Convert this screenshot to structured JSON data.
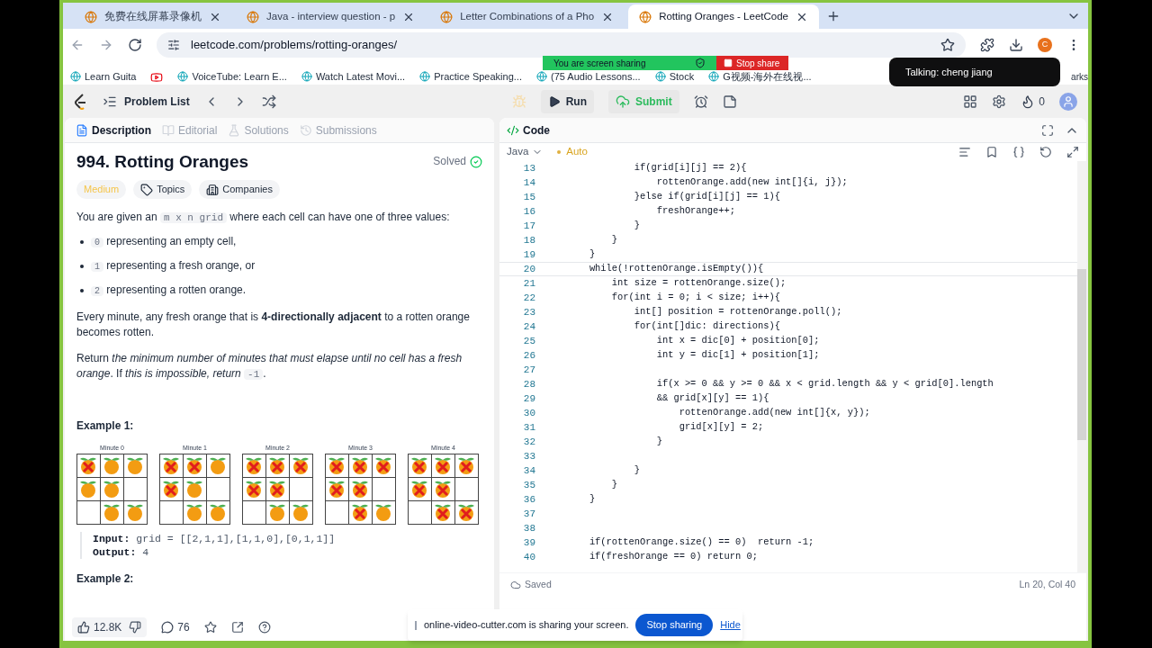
{
  "browser": {
    "tabs": [
      {
        "title": "免费在线屏幕录像机",
        "selected": false
      },
      {
        "title": "Java - interview question - p",
        "selected": false
      },
      {
        "title": "Letter Combinations of a Pho",
        "selected": false
      },
      {
        "title": "Rotting Oranges - LeetCode",
        "selected": true
      }
    ],
    "url": "leetcode.com/problems/rotting-oranges/",
    "bookmarks": [
      {
        "kind": "link",
        "label": "Learn Guita"
      },
      {
        "kind": "icon"
      },
      {
        "kind": "link",
        "label": "VoiceTube: Learn E..."
      },
      {
        "kind": "link",
        "label": "Watch Latest Movi..."
      },
      {
        "kind": "link",
        "label": "Practice Speaking..."
      },
      {
        "kind": "link",
        "label": "(75 Audio Lessons..."
      },
      {
        "kind": "link",
        "label": "Stock"
      },
      {
        "kind": "link",
        "label": "G视频-海外在线视..."
      }
    ],
    "bookmarks_end": "arks",
    "profile_initial": "C"
  },
  "share_banner": {
    "text": "You are screen sharing",
    "button": "Stop share"
  },
  "talking": "Talking: cheng jiang",
  "nav": {
    "problem_list": "Problem List",
    "run": "Run",
    "submit": "Submit",
    "streak": "0"
  },
  "left_tabs": [
    {
      "label": "Description",
      "selected": true
    },
    {
      "label": "Editorial",
      "selected": false
    },
    {
      "label": "Solutions",
      "selected": false
    },
    {
      "label": "Submissions",
      "selected": false
    }
  ],
  "problem": {
    "title": "994. Rotting Oranges",
    "status": "Solved",
    "difficulty": "Medium",
    "tags": [
      "Topics",
      "Companies"
    ],
    "intro": [
      {
        "kind": "text",
        "text": "You are given an "
      },
      {
        "kind": "code",
        "text": "m x n grid"
      },
      {
        "kind": "text",
        "text": " where each cell can have one of three values:"
      }
    ],
    "bullets": [
      {
        "code": "0",
        "text": "representing an empty cell,"
      },
      {
        "code": "1",
        "text": "representing a fresh orange, or"
      },
      {
        "code": "2",
        "text": "representing a rotten orange."
      }
    ],
    "rule": "Every minute, any fresh orange that is **4-directionally adjacent** to a rotten orange becomes rotten.",
    "goal": [
      {
        "kind": "text",
        "text": "Return "
      },
      {
        "kind": "italic",
        "text": "the minimum number of minutes that must elapse until no cell has a fresh orange"
      },
      {
        "kind": "text",
        "text": ". If "
      },
      {
        "kind": "italic",
        "text": "this is impossible, return "
      },
      {
        "kind": "code",
        "text": "-1"
      },
      {
        "kind": "text",
        "text": "."
      }
    ],
    "example_title": "Example 1:",
    "grids": [
      {
        "caption": "Minute 0",
        "cells": [
          [
            {
              "kind": "rotten"
            },
            {
              "kind": "fresh"
            },
            {
              "kind": "fresh"
            }
          ],
          [
            {
              "kind": "fresh"
            },
            {
              "kind": "fresh"
            },
            {
              "kind": "empty"
            }
          ],
          [
            {
              "kind": "empty"
            },
            {
              "kind": "fresh"
            },
            {
              "kind": "fresh"
            }
          ]
        ]
      },
      {
        "caption": "Minute 1",
        "cells": [
          [
            {
              "kind": "rotten"
            },
            {
              "kind": "rotten"
            },
            {
              "kind": "fresh"
            }
          ],
          [
            {
              "kind": "rotten"
            },
            {
              "kind": "fresh"
            },
            {
              "kind": "empty"
            }
          ],
          [
            {
              "kind": "empty"
            },
            {
              "kind": "fresh"
            },
            {
              "kind": "fresh"
            }
          ]
        ]
      },
      {
        "caption": "Minute 2",
        "cells": [
          [
            {
              "kind": "rotten"
            },
            {
              "kind": "rotten"
            },
            {
              "kind": "rotten"
            }
          ],
          [
            {
              "kind": "rotten"
            },
            {
              "kind": "rotten"
            },
            {
              "kind": "empty"
            }
          ],
          [
            {
              "kind": "empty"
            },
            {
              "kind": "fresh"
            },
            {
              "kind": "fresh"
            }
          ]
        ]
      },
      {
        "caption": "Minute 3",
        "cells": [
          [
            {
              "kind": "rotten"
            },
            {
              "kind": "rotten"
            },
            {
              "kind": "rotten"
            }
          ],
          [
            {
              "kind": "rotten"
            },
            {
              "kind": "rotten"
            },
            {
              "kind": "empty"
            }
          ],
          [
            {
              "kind": "empty"
            },
            {
              "kind": "rotten"
            },
            {
              "kind": "fresh"
            }
          ]
        ]
      },
      {
        "caption": "Minute 4",
        "cells": [
          [
            {
              "kind": "rotten"
            },
            {
              "kind": "rotten"
            },
            {
              "kind": "rotten"
            }
          ],
          [
            {
              "kind": "rotten"
            },
            {
              "kind": "rotten"
            },
            {
              "kind": "empty"
            }
          ],
          [
            {
              "kind": "empty"
            },
            {
              "kind": "rotten"
            },
            {
              "kind": "rotten"
            }
          ]
        ]
      }
    ],
    "io": [
      {
        "label": "Input:",
        "value": "grid = [[2,1,1],[1,1,0],[0,1,1]]"
      },
      {
        "label": "Output:",
        "value": "4"
      }
    ],
    "next_example": "Example 2:",
    "likes": "12.8K",
    "comments": "76"
  },
  "editor": {
    "title": "Code",
    "language": "Java",
    "mode": "Auto",
    "lines": [
      {
        "number": "13",
        "text": "                if(grid[i][j] == 2){",
        "current": false
      },
      {
        "number": "14",
        "text": "                    rottenOrange.add(new int[]{i, j});",
        "current": false
      },
      {
        "number": "15",
        "text": "                }else if(grid[i][j] == 1){",
        "current": false
      },
      {
        "number": "16",
        "text": "                    freshOrange++;",
        "current": false
      },
      {
        "number": "17",
        "text": "                }",
        "current": false
      },
      {
        "number": "18",
        "text": "            }",
        "current": false
      },
      {
        "number": "19",
        "text": "        }",
        "current": false
      },
      {
        "number": "20",
        "text": "        while(!rottenOrange.isEmpty()){",
        "current": true
      },
      {
        "number": "21",
        "text": "            int size = rottenOrange.size();",
        "current": false
      },
      {
        "number": "22",
        "text": "            for(int i = 0; i < size; i++){",
        "current": false
      },
      {
        "number": "23",
        "text": "                int[] position = rottenOrange.poll();",
        "current": false
      },
      {
        "number": "24",
        "text": "                for(int[]dic: directions){",
        "current": false
      },
      {
        "number": "25",
        "text": "                    int x = dic[0] + position[0];",
        "current": false
      },
      {
        "number": "26",
        "text": "                    int y = dic[1] + position[1];",
        "current": false
      },
      {
        "number": "27",
        "current": false
      },
      {
        "number": "28",
        "text": "                    if(x >= 0 && y >= 0 && x < grid.length && y < grid[0].length",
        "current": false
      },
      {
        "number": "29",
        "text": "                    && grid[x][y] == 1){",
        "current": false
      },
      {
        "number": "30",
        "text": "                        rottenOrange.add(new int[]{x, y});",
        "current": false
      },
      {
        "number": "31",
        "text": "                        grid[x][y] = 2;",
        "current": false
      },
      {
        "number": "32",
        "text": "                    }",
        "current": false
      },
      {
        "number": "33",
        "current": false
      },
      {
        "number": "34",
        "text": "                }",
        "current": false
      },
      {
        "number": "35",
        "text": "            }",
        "current": false
      },
      {
        "number": "36",
        "text": "        }",
        "current": false
      },
      {
        "number": "37",
        "current": false
      },
      {
        "number": "38",
        "current": false
      },
      {
        "number": "39",
        "text": "        if(rottenOrange.size() == 0)  return -1;",
        "current": false
      },
      {
        "number": "40",
        "text": "        if(freshOrange == 0) return 0;",
        "current": false
      }
    ],
    "saved": "Saved",
    "position": "Ln 20, Col 40"
  },
  "share_notice": {
    "text": "online-video-cutter.com is sharing your screen.",
    "stop": "Stop sharing",
    "hide": "Hide"
  }
}
